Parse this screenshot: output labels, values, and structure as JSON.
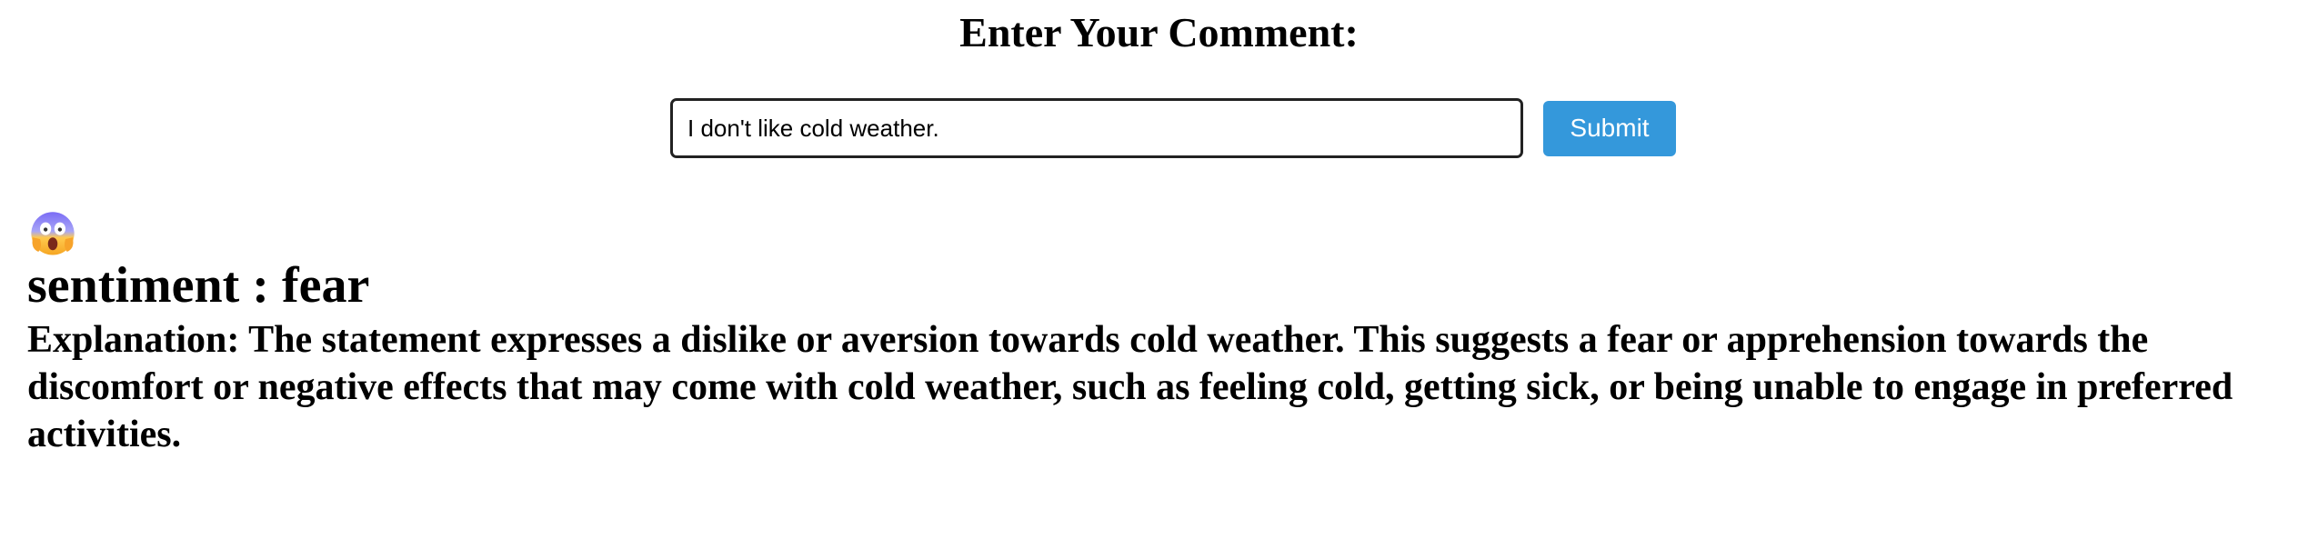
{
  "form": {
    "heading": "Enter Your Comment:",
    "input_value": "I don't like cold weather.",
    "submit_label": "Submit"
  },
  "result": {
    "emoji_icon": "face-screaming-in-fear-icon",
    "sentiment_text": "sentiment : fear",
    "explanation_text": "Explanation: The statement expresses a dislike or aversion towards cold weather. This suggests a fear or apprehension towards the discomfort or negative effects that may come with cold weather, such as feeling cold, getting sick, or being unable to engage in preferred activities."
  },
  "colors": {
    "submit_background": "#3498db",
    "submit_text": "#ffffff",
    "input_border": "#222222"
  }
}
